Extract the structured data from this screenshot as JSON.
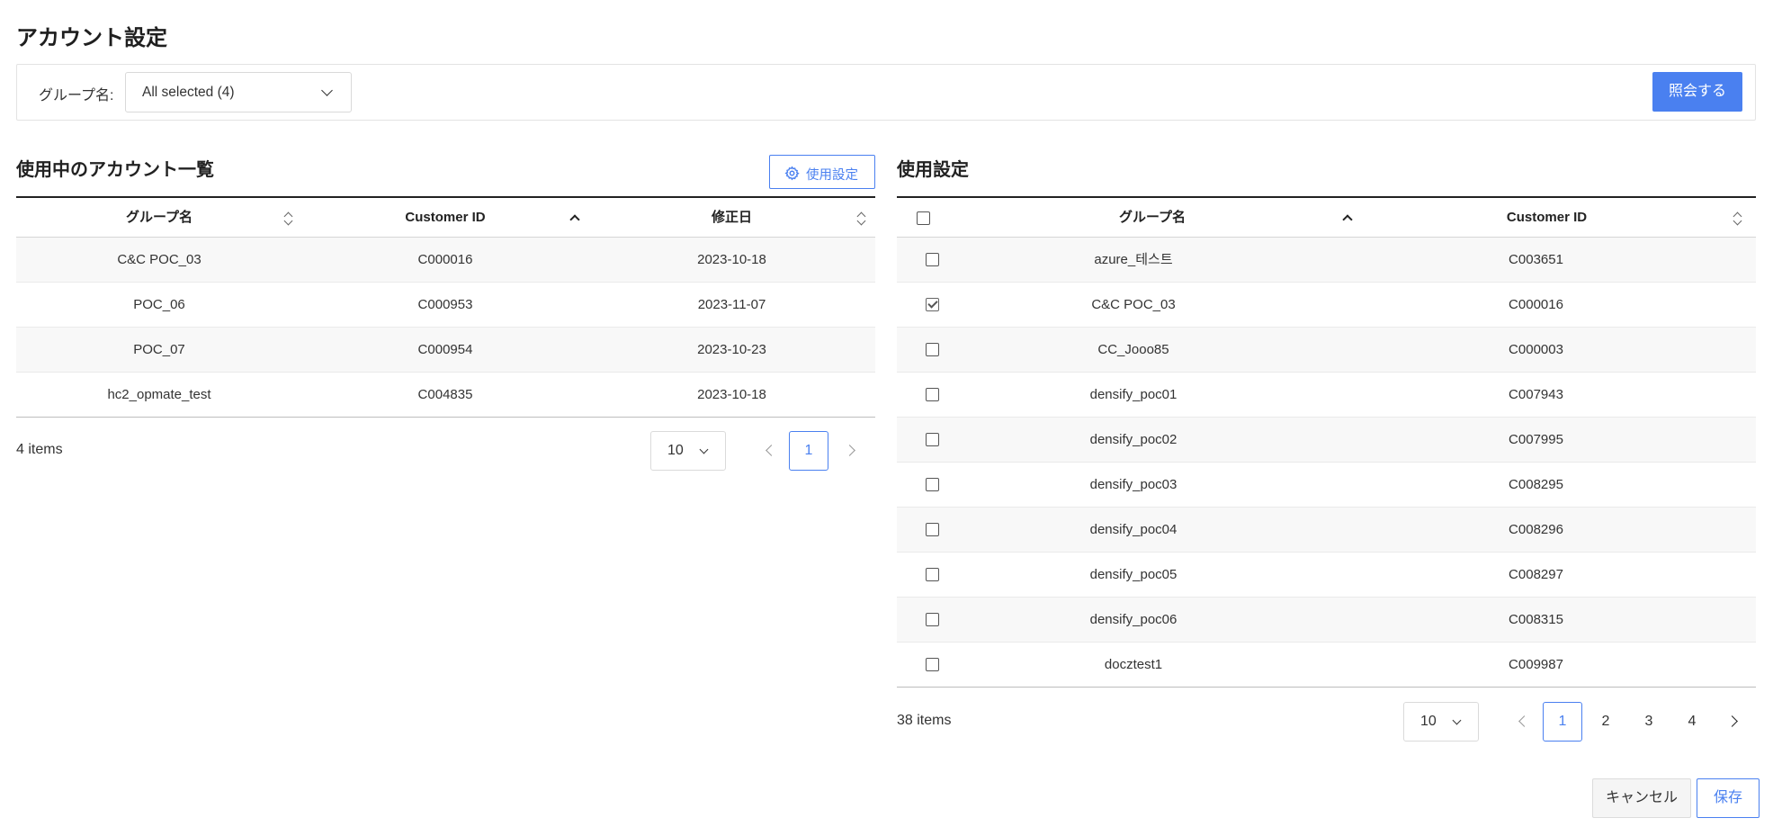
{
  "page": {
    "title": "アカウント設定"
  },
  "filter": {
    "label": "グループ名:",
    "select_value": "All selected (4)",
    "search_button": "照会する"
  },
  "left": {
    "title": "使用中のアカウント一覧",
    "settings_button": "使用設定",
    "columns": [
      "グループ名",
      "Customer ID",
      "修正日"
    ],
    "sorted_column": "Customer ID",
    "rows": [
      {
        "group": "C&C POC_03",
        "customer_id": "C000016",
        "modified": "2023-10-18"
      },
      {
        "group": "POC_06",
        "customer_id": "C000953",
        "modified": "2023-11-07"
      },
      {
        "group": "POC_07",
        "customer_id": "C000954",
        "modified": "2023-10-23"
      },
      {
        "group": "hc2_opmate_test",
        "customer_id": "C004835",
        "modified": "2023-10-18"
      }
    ],
    "total": "4 items",
    "page_size": "10",
    "pages": [
      "1"
    ],
    "current_page": "1"
  },
  "right": {
    "title": "使用設定",
    "columns": [
      "グループ名",
      "Customer ID"
    ],
    "sorted_column": "グループ名",
    "rows": [
      {
        "group": "azure_테스트",
        "customer_id": "C003651",
        "checked": false
      },
      {
        "group": "C&C POC_03",
        "customer_id": "C000016",
        "checked": true
      },
      {
        "group": "CC_Jooo85",
        "customer_id": "C000003",
        "checked": false
      },
      {
        "group": "densify_poc01",
        "customer_id": "C007943",
        "checked": false
      },
      {
        "group": "densify_poc02",
        "customer_id": "C007995",
        "checked": false
      },
      {
        "group": "densify_poc03",
        "customer_id": "C008295",
        "checked": false
      },
      {
        "group": "densify_poc04",
        "customer_id": "C008296",
        "checked": false
      },
      {
        "group": "densify_poc05",
        "customer_id": "C008297",
        "checked": false
      },
      {
        "group": "densify_poc06",
        "customer_id": "C008315",
        "checked": false
      },
      {
        "group": "docztest1",
        "customer_id": "C009987",
        "checked": false
      }
    ],
    "total": "38 items",
    "page_size": "10",
    "pages": [
      "1",
      "2",
      "3",
      "4"
    ],
    "current_page": "1"
  },
  "footer": {
    "cancel": "キャンセル",
    "save": "保存"
  },
  "colors": {
    "accent": "#4a80f0",
    "header_border": "#222222",
    "row_alt": "#f8f8f8"
  }
}
